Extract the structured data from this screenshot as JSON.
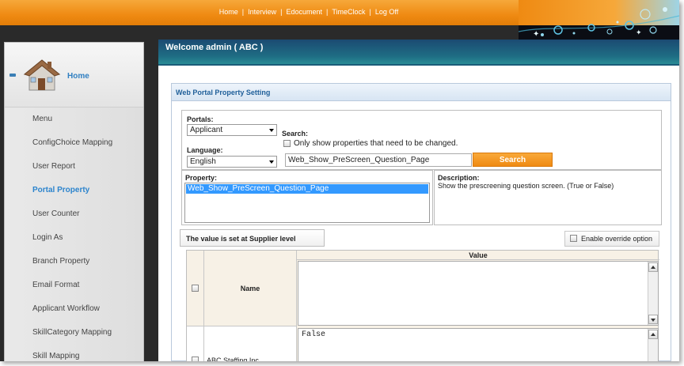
{
  "topnav": {
    "links": [
      "Home",
      "Interview",
      "Edocument",
      "TimeClock",
      "Log Off"
    ],
    "separator": "|"
  },
  "sidebar": {
    "home_label": "Home",
    "items": [
      {
        "label": "Menu"
      },
      {
        "label": "ConfigChoice Mapping"
      },
      {
        "label": "User Report"
      },
      {
        "label": "Portal Property",
        "active": true
      },
      {
        "label": "User Counter"
      },
      {
        "label": "Login As"
      },
      {
        "label": "Branch Property"
      },
      {
        "label": "Email Format"
      },
      {
        "label": "Applicant Workflow"
      },
      {
        "label": "SkillCategory Mapping"
      },
      {
        "label": "Skill Mapping"
      }
    ]
  },
  "header": {
    "welcome": "Welcome admin ( ABC )"
  },
  "panel": {
    "title": "Web Portal Property Setting",
    "portals_label": "Portals:",
    "portals_value": "Applicant",
    "language_label": "Language:",
    "language_value": "English",
    "search_label": "Search:",
    "only_show_label": "Only show properties that need to be changed.",
    "search_value": "Web_Show_PreScreen_Question_Page",
    "search_button": "Search",
    "property_label": "Property:",
    "property_selected": "Web_Show_PreScreen_Question_Page",
    "description_label": "Description:",
    "description_text": "Show the prescreening question screen. (True or False)",
    "level_text": "The value is set at Supplier level",
    "override_label": "Enable override option",
    "grid": {
      "name_header": "Name",
      "value_header": "Value",
      "row1_name": "ABC Staffing Inc",
      "row1_value": "False"
    }
  },
  "colors": {
    "accent_orange": "#ef8a12",
    "header_teal": "#1f6e84",
    "link_blue": "#2c84cd"
  }
}
